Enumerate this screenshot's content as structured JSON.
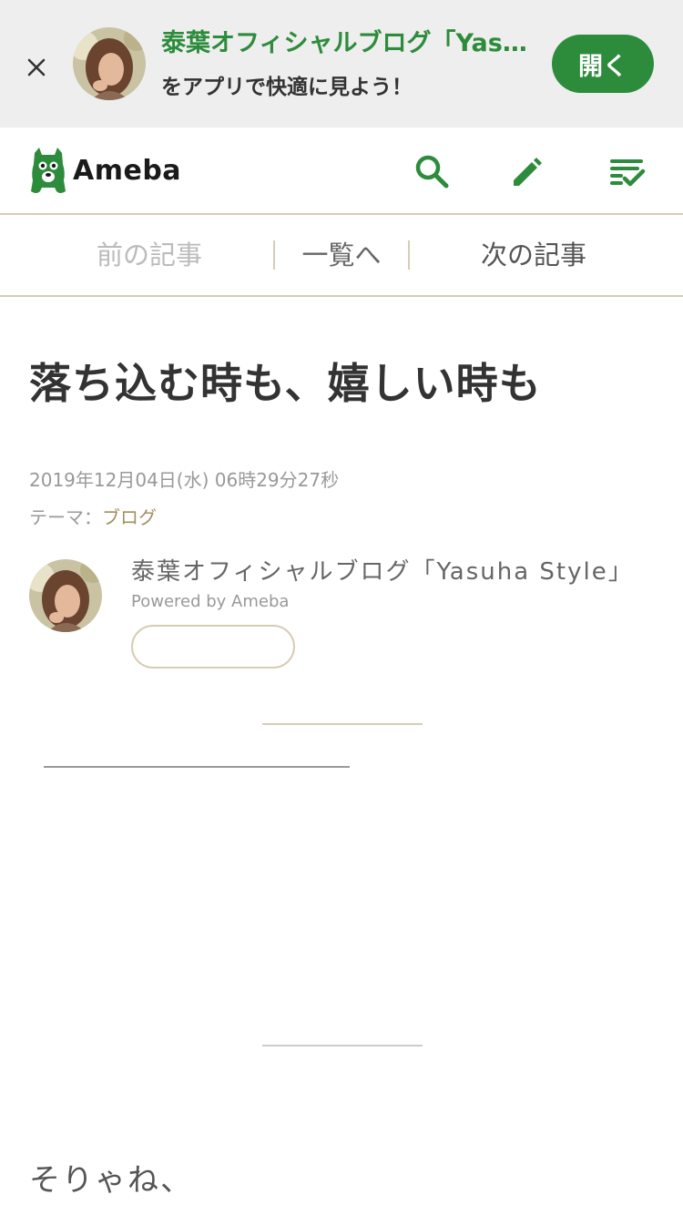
{
  "colors": {
    "brand_green": "#2d8c3c",
    "accent_beige": "#d7cdb5",
    "theme_link": "#a3905f",
    "banner_bg": "#eeeeee"
  },
  "app_banner": {
    "close_icon": "close-icon",
    "title": "泰葉オフィシャルブログ「Yasuha Style」",
    "subtitle": "をアプリで快適に見よう！",
    "open_label": "開く"
  },
  "header": {
    "logo_text": "Ameba",
    "icons": [
      "search-icon",
      "pencil-icon",
      "reading-list-icon"
    ]
  },
  "article_nav": {
    "prev_label": "前の記事",
    "list_label": "一覧へ",
    "next_label": "次の記事"
  },
  "article": {
    "title": "落ち込む時も、嬉しい時も",
    "date": "2019年12月04日(水) 06時29分27秒",
    "theme_label": "テーマ：",
    "theme_value": "ブログ",
    "body_first_line": "そりゃね、"
  },
  "author": {
    "name": "泰葉オフィシャルブログ「Yasuha Style」",
    "powered_by": "Powered by Ameba",
    "follow_label": ""
  }
}
